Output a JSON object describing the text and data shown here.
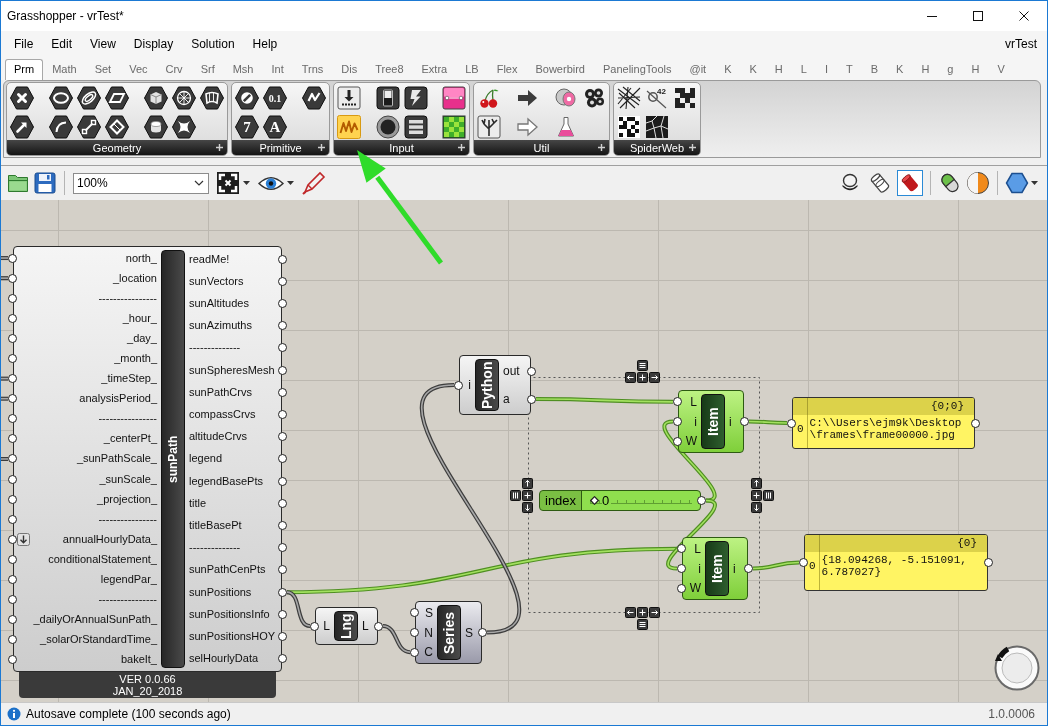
{
  "window": {
    "title": "Grasshopper - vrTest*"
  },
  "menu_bar": {
    "items": [
      "File",
      "Edit",
      "View",
      "Display",
      "Solution",
      "Help"
    ],
    "document_name": "vrTest"
  },
  "tabs": [
    {
      "label": "Prm",
      "selected": true
    },
    {
      "label": "Math",
      "selected": false
    },
    {
      "label": "Set",
      "selected": false
    },
    {
      "label": "Vec",
      "selected": false
    },
    {
      "label": "Crv",
      "selected": false
    },
    {
      "label": "Srf",
      "selected": false
    },
    {
      "label": "Msh",
      "selected": false
    },
    {
      "label": "Int",
      "selected": false
    },
    {
      "label": "Trns",
      "selected": false
    },
    {
      "label": "Dis",
      "selected": false
    },
    {
      "label": "Tree8",
      "selected": false
    },
    {
      "label": "Extra",
      "selected": false
    },
    {
      "label": "LB",
      "selected": false
    },
    {
      "label": "Flex",
      "selected": false
    },
    {
      "label": "Bowerbird",
      "selected": false
    },
    {
      "label": "PanelingTools",
      "selected": false
    },
    {
      "label": "@it",
      "selected": false
    },
    {
      "label": "K",
      "selected": false
    },
    {
      "label": "K",
      "selected": false
    },
    {
      "label": "H",
      "selected": false
    },
    {
      "label": "L",
      "selected": false
    },
    {
      "label": "I",
      "selected": false
    },
    {
      "label": "T",
      "selected": false
    },
    {
      "label": "B",
      "selected": false
    },
    {
      "label": "K",
      "selected": false
    },
    {
      "label": "H",
      "selected": false
    },
    {
      "label": "g",
      "selected": false
    },
    {
      "label": "H",
      "selected": false
    },
    {
      "label": "V",
      "selected": false
    }
  ],
  "ribbon": {
    "panels": [
      {
        "label": "Geometry",
        "groups": [
          [
            {
              "kind": "hex-cross",
              "highlighted": false
            },
            {
              "kind": "hex-arrow",
              "highlighted": false
            }
          ],
          [
            {
              "kind": "hex-ellipse",
              "highlighted": false
            },
            {
              "kind": "hex-arc",
              "highlighted": false
            },
            {
              "kind": "hex-rings",
              "highlighted": false
            },
            {
              "kind": "hex-line",
              "highlighted": false
            },
            {
              "kind": "hex-plane",
              "highlighted": false
            },
            {
              "kind": "hex-diamond",
              "highlighted": false
            }
          ],
          [
            {
              "kind": "hex-cube",
              "highlighted": false
            },
            {
              "kind": "hex-cylinder",
              "highlighted": false
            },
            {
              "kind": "hex-mesh",
              "highlighted": false
            },
            {
              "kind": "hex-star",
              "highlighted": false
            },
            {
              "kind": "hex-surface",
              "highlighted": false
            }
          ]
        ]
      },
      {
        "label": "Primitive",
        "groups": [
          [
            {
              "kind": "hex-circle",
              "highlighted": false
            },
            {
              "kind": "hex-glyph",
              "glyph": "7",
              "highlighted": false
            },
            {
              "kind": "hex-glyph",
              "glyph": "0.1",
              "highlighted": false
            },
            {
              "kind": "hex-glyph",
              "glyph": "A",
              "highlighted": false
            }
          ],
          [
            {
              "kind": "hex-zigzag",
              "highlighted": false
            }
          ]
        ]
      },
      {
        "label": "Input",
        "groups": [
          [
            {
              "kind": "download",
              "highlighted": false
            },
            {
              "kind": "graph",
              "highlighted": true
            }
          ],
          [
            {
              "kind": "toggle",
              "highlighted": false
            },
            {
              "kind": "round-button",
              "highlighted": false
            },
            {
              "kind": "lightning",
              "highlighted": false
            },
            {
              "kind": "list",
              "highlighted": false
            }
          ],
          [
            {
              "kind": "gradient",
              "highlighted": false
            },
            {
              "kind": "pixel-grid",
              "highlighted": false
            }
          ]
        ]
      },
      {
        "label": "Util",
        "groups": [
          [
            {
              "kind": "cherries",
              "highlighted": false
            },
            {
              "kind": "tree",
              "highlighted": false
            }
          ],
          [
            {
              "kind": "solid-arrow",
              "highlighted": false
            },
            {
              "kind": "outline-arrow",
              "highlighted": false
            }
          ],
          [
            {
              "kind": "discs",
              "highlighted": false
            },
            {
              "kind": "flask",
              "highlighted": false
            },
            {
              "kind": "circles",
              "highlighted": false
            }
          ]
        ]
      },
      {
        "label": "SpiderWeb",
        "groups": [
          [
            {
              "kind": "tangle",
              "highlighted": false
            },
            {
              "kind": "checker",
              "highlighted": false
            },
            {
              "kind": "numbered-node",
              "glyph": "42",
              "highlighted": false
            },
            {
              "kind": "cells",
              "highlighted": false
            },
            {
              "kind": "dots",
              "highlighted": false
            }
          ]
        ]
      }
    ]
  },
  "canvas_toolbar": {
    "zoom": "100%",
    "display_modes": [
      {
        "kind": "blob",
        "selected": false
      },
      {
        "kind": "wire-cylinder",
        "selected": false
      },
      {
        "kind": "solid-cylinder",
        "selected": true
      }
    ]
  },
  "canvas": {
    "nodes": [
      {
        "kind": "component",
        "name": "sunPath",
        "selected": false,
        "preview": true,
        "inputs": [
          {
            "label": "north_",
            "flatten": false
          },
          {
            "label": "_location",
            "flatten": false
          },
          {
            "label": "----------------",
            "flatten": false
          },
          {
            "label": "_hour_",
            "flatten": false
          },
          {
            "label": "_day_",
            "flatten": false
          },
          {
            "label": "_month_",
            "flatten": false
          },
          {
            "label": "_timeStep_",
            "flatten": false
          },
          {
            "label": "analysisPeriod_",
            "flatten": false
          },
          {
            "label": "----------------",
            "flatten": false
          },
          {
            "label": "_centerPt_",
            "flatten": false
          },
          {
            "label": "_sunPathScale_",
            "flatten": false
          },
          {
            "label": "_sunScale_",
            "flatten": false
          },
          {
            "label": "_projection_",
            "flatten": false
          },
          {
            "label": "----------------",
            "flatten": false
          },
          {
            "label": "annualHourlyData_",
            "flatten": true
          },
          {
            "label": "conditionalStatement_",
            "flatten": false
          },
          {
            "label": "legendPar_",
            "flatten": false
          },
          {
            "label": "----------------",
            "flatten": false
          },
          {
            "label": "_dailyOrAnnualSunPath_",
            "flatten": false
          },
          {
            "label": "_solarOrStandardTime_",
            "flatten": false
          },
          {
            "label": "bakeIt_",
            "flatten": false
          }
        ],
        "outputs": [
          "readMe!",
          "sunVectors",
          "sunAltitudes",
          "sunAzimuths",
          "--------------",
          "sunSpheresMesh",
          "sunPathCrvs",
          "compassCrvs",
          "altitudeCrvs",
          "legend",
          "legendBasePts",
          "title",
          "titleBasePt",
          "--------------",
          "sunPathCenPts",
          "sunPositions",
          "sunPositionsInfo",
          "sunPositionsHOY",
          "selHourlyData"
        ],
        "footer": [
          "VER 0.0.66",
          "JAN_20_2018"
        ]
      },
      {
        "kind": "component",
        "name": "Python",
        "selected": false,
        "preview": true,
        "inputs": [
          {
            "label": "i",
            "flatten": false
          }
        ],
        "outputs": [
          "out",
          "a"
        ]
      },
      {
        "kind": "component",
        "name": "Item",
        "selected": true,
        "preview": true,
        "inputs": [
          {
            "label": "L",
            "flatten": false
          },
          {
            "label": "i",
            "flatten": false
          },
          {
            "label": "W",
            "flatten": false
          }
        ],
        "outputs": [
          "i"
        ]
      },
      {
        "kind": "slider",
        "label": "index",
        "value": "0",
        "level": 0,
        "selected": true
      },
      {
        "kind": "component",
        "name": "Item",
        "selected": true,
        "preview": true,
        "inputs": [
          {
            "label": "L",
            "flatten": false
          },
          {
            "label": "i",
            "flatten": false
          },
          {
            "label": "W",
            "flatten": false
          }
        ],
        "outputs": [
          "i"
        ]
      },
      {
        "kind": "component",
        "name": "Lng",
        "selected": false,
        "preview": true,
        "inputs": [
          {
            "label": "L",
            "flatten": false
          }
        ],
        "outputs": [
          "L"
        ]
      },
      {
        "kind": "component",
        "name": "Series",
        "selected": false,
        "preview": false,
        "inputs": [
          {
            "label": "S",
            "flatten": false
          },
          {
            "label": "N",
            "flatten": false
          },
          {
            "label": "C",
            "flatten": false
          }
        ],
        "outputs": [
          "S"
        ]
      },
      {
        "kind": "panel",
        "path": "{0;0}",
        "index": "0",
        "text": "C:\\\\Users\\ejm9k\\Desktop\\frames\\frame00000.jpg"
      },
      {
        "kind": "panel",
        "path": "{0}",
        "index": "0",
        "text": "{18.094268, -5.151091, 6.787027}"
      }
    ]
  },
  "status_bar": {
    "message": "Autosave complete (100 seconds ago)",
    "version": "1.0.0006"
  }
}
